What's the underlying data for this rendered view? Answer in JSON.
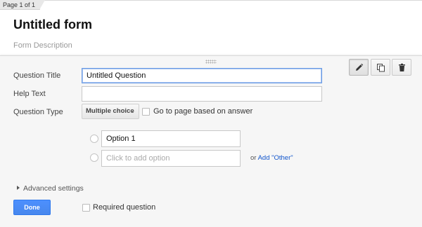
{
  "page_indicator": "Page 1 of 1",
  "form": {
    "title": "Untitled form",
    "description": "Form Description"
  },
  "toolbar": {
    "edit_icon": "pencil-icon",
    "duplicate_icon": "duplicate-icon",
    "delete_icon": "trash-icon"
  },
  "question": {
    "title_label": "Question Title",
    "title_value": "Untitled Question",
    "help_label": "Help Text",
    "help_value": "",
    "type_label": "Question Type",
    "type_value": "Multiple choice",
    "go_to_page_label": "Go to page based on answer",
    "go_to_page_checked": false,
    "options": [
      {
        "value": "Option 1"
      }
    ],
    "add_option_placeholder": "Click to add option",
    "or_text": "or",
    "add_other_label": "Add \"Other\"",
    "advanced_settings_label": "Advanced settings",
    "done_label": "Done",
    "required_label": "Required question",
    "required_checked": false
  },
  "colors": {
    "accent_blue": "#4d90fe",
    "link_blue": "#1155cc",
    "focus_border": "#6a9be5"
  }
}
